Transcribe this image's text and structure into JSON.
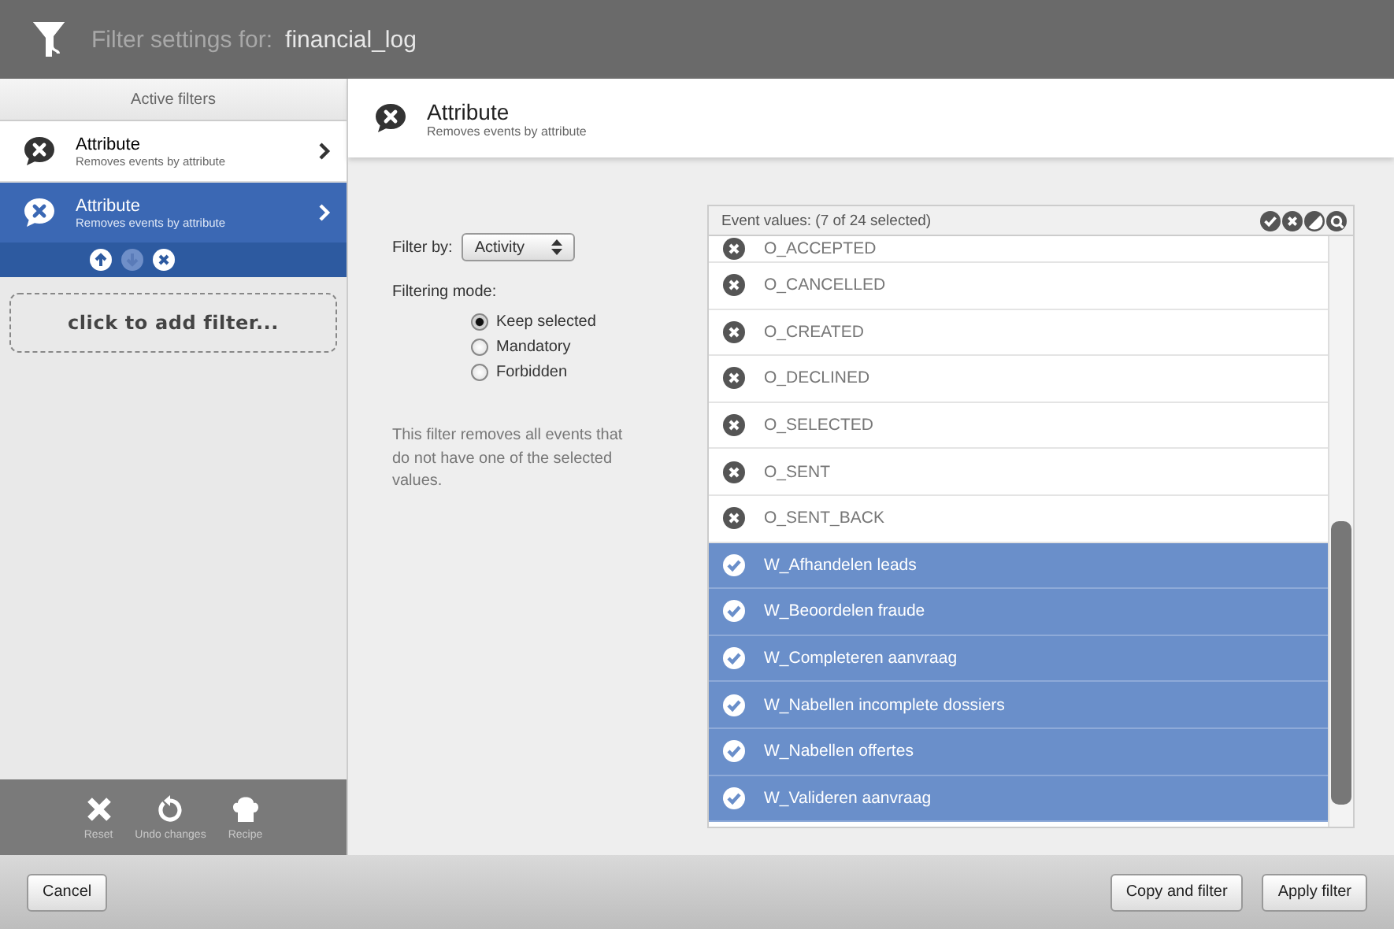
{
  "header": {
    "label": "Filter settings for:",
    "log_name": "financial_log"
  },
  "sidebar": {
    "title": "Active filters",
    "items": [
      {
        "title": "Attribute",
        "subtitle": "Removes events by attribute",
        "selected": false
      },
      {
        "title": "Attribute",
        "subtitle": "Removes events by attribute",
        "selected": true
      }
    ],
    "add_filter": "click to add filter...",
    "toolbar": [
      {
        "kind": "reset",
        "label": "Reset"
      },
      {
        "kind": "undo",
        "label": "Undo changes"
      },
      {
        "kind": "recipe",
        "label": "Recipe"
      }
    ]
  },
  "detail": {
    "title": "Attribute",
    "subtitle": "Removes events by attribute",
    "filter_by_label": "Filter by:",
    "filter_by_value": "Activity",
    "mode_label": "Filtering mode:",
    "modes": [
      {
        "label": "Keep selected",
        "selected": true
      },
      {
        "label": "Mandatory",
        "selected": false
      },
      {
        "label": "Forbidden",
        "selected": false
      }
    ],
    "description": "This filter removes all events that do not have one of the selected values.",
    "values_title": "Event values:  (7 of 24 selected)",
    "values": [
      {
        "label": "O_ACCEPTED",
        "selected": false
      },
      {
        "label": "O_CANCELLED",
        "selected": false
      },
      {
        "label": "O_CREATED",
        "selected": false
      },
      {
        "label": "O_DECLINED",
        "selected": false
      },
      {
        "label": "O_SELECTED",
        "selected": false
      },
      {
        "label": "O_SENT",
        "selected": false
      },
      {
        "label": "O_SENT_BACK",
        "selected": false
      },
      {
        "label": "W_Afhandelen leads",
        "selected": true
      },
      {
        "label": "W_Beoordelen fraude",
        "selected": true
      },
      {
        "label": "W_Completeren aanvraag",
        "selected": true
      },
      {
        "label": "W_Nabellen incomplete dossiers",
        "selected": true
      },
      {
        "label": "W_Nabellen offertes",
        "selected": true
      },
      {
        "label": "W_Valideren aanvraag",
        "selected": true
      }
    ]
  },
  "buttons": {
    "cancel": "Cancel",
    "copy": "Copy and filter",
    "apply": "Apply filter"
  }
}
